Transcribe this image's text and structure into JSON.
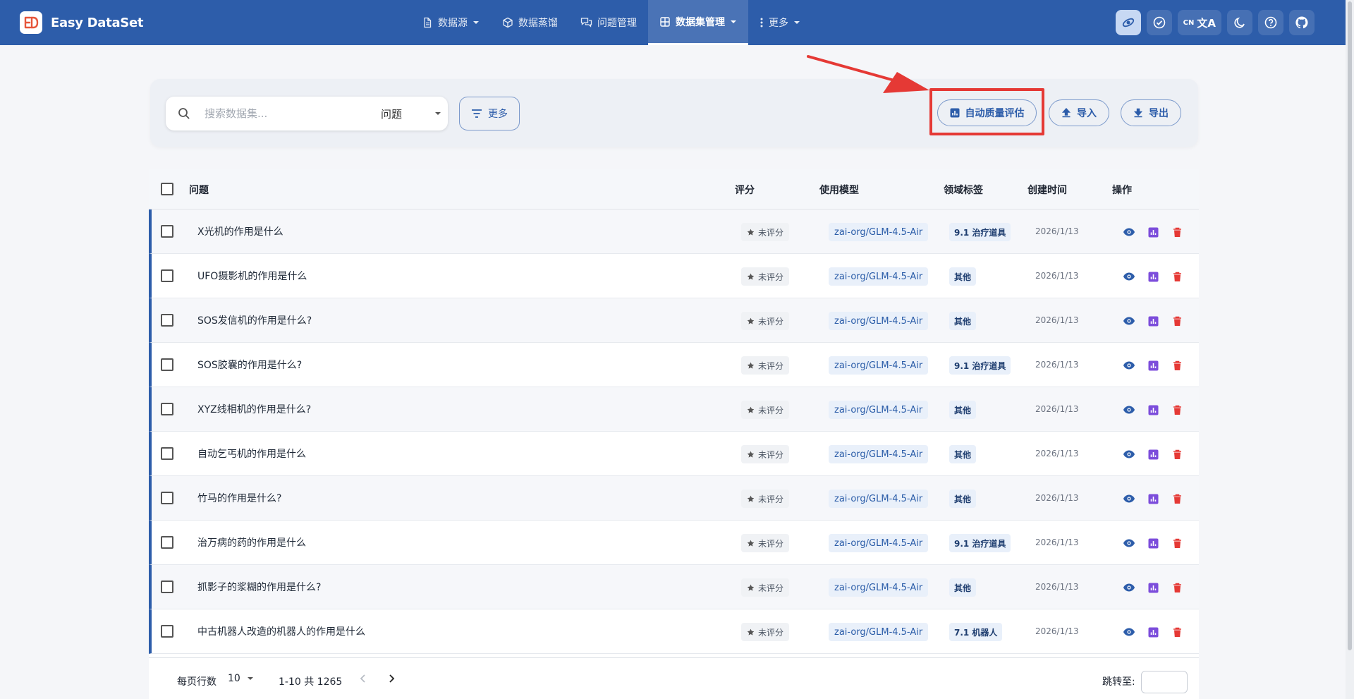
{
  "app": {
    "name": "Easy DataSet"
  },
  "nav": [
    {
      "label": "数据源",
      "icon": "file-icon",
      "dropdown": true,
      "active": false
    },
    {
      "label": "数据蒸馏",
      "icon": "cube-icon",
      "dropdown": false,
      "active": false
    },
    {
      "label": "问题管理",
      "icon": "chat-icon",
      "dropdown": false,
      "active": false
    },
    {
      "label": "数据集管理",
      "icon": "grid-icon",
      "dropdown": true,
      "active": true
    },
    {
      "label": "更多",
      "icon": "more-vert-icon",
      "dropdown": true,
      "active": false
    }
  ],
  "header_tools": {
    "lang_code": "CN",
    "lang_glyph": "文A",
    "icons": [
      "model-icon",
      "check-circle-icon",
      "translate-icon",
      "moon-icon",
      "help-icon",
      "github-icon"
    ]
  },
  "search": {
    "placeholder": "搜索数据集...",
    "field": "问题"
  },
  "buttons": {
    "more": "更多",
    "auto_eval": "自动质量评估",
    "import": "导入",
    "export": "导出"
  },
  "table": {
    "headers": {
      "question": "问题",
      "score": "评分",
      "model": "使用模型",
      "tag": "领域标签",
      "created": "创建时间",
      "actions": "操作"
    },
    "rows": [
      {
        "question": "X光机的作用是什么",
        "score": "未评分",
        "model": "zai-org/GLM-4.5-Air",
        "tag": "9.1 治疗道具",
        "date": "2026/1/13"
      },
      {
        "question": "UFO摄影机的作用是什么",
        "score": "未评分",
        "model": "zai-org/GLM-4.5-Air",
        "tag": "其他",
        "date": "2026/1/13"
      },
      {
        "question": "SOS发信机的作用是什么?",
        "score": "未评分",
        "model": "zai-org/GLM-4.5-Air",
        "tag": "其他",
        "date": "2026/1/13"
      },
      {
        "question": "SOS胶囊的作用是什么?",
        "score": "未评分",
        "model": "zai-org/GLM-4.5-Air",
        "tag": "9.1 治疗道具",
        "date": "2026/1/13"
      },
      {
        "question": "XYZ线相机的作用是什么?",
        "score": "未评分",
        "model": "zai-org/GLM-4.5-Air",
        "tag": "其他",
        "date": "2026/1/13"
      },
      {
        "question": "自动乞丐机的作用是什么",
        "score": "未评分",
        "model": "zai-org/GLM-4.5-Air",
        "tag": "其他",
        "date": "2026/1/13"
      },
      {
        "question": "竹马的作用是什么?",
        "score": "未评分",
        "model": "zai-org/GLM-4.5-Air",
        "tag": "其他",
        "date": "2026/1/13"
      },
      {
        "question": "治万病的药的作用是什么",
        "score": "未评分",
        "model": "zai-org/GLM-4.5-Air",
        "tag": "9.1 治疗道具",
        "date": "2026/1/13"
      },
      {
        "question": "抓影子的浆糊的作用是什么?",
        "score": "未评分",
        "model": "zai-org/GLM-4.5-Air",
        "tag": "其他",
        "date": "2026/1/13"
      },
      {
        "question": "中古机器人改造的机器人的作用是什么",
        "score": "未评分",
        "model": "zai-org/GLM-4.5-Air",
        "tag": "7.1 机器人",
        "date": "2026/1/13"
      }
    ]
  },
  "pagination": {
    "rows_per_page_label": "每页行数",
    "rows_per_page": "10",
    "range": "1-10 共 1265",
    "jump_label": "跳转至:"
  },
  "colors": {
    "header_bg": "#2d5daa",
    "accent": "#2d5daa",
    "highlight": "#e53935",
    "delete": "#e53935",
    "eval": "#7c4ddb"
  }
}
